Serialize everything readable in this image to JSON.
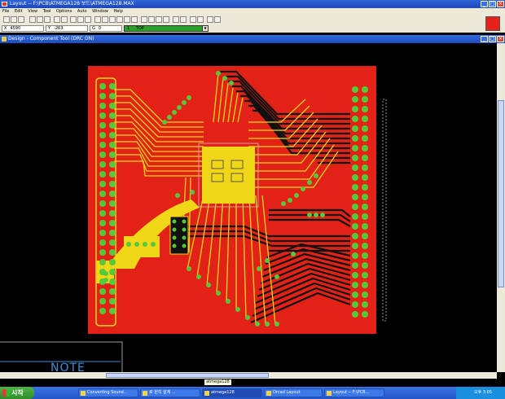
{
  "window": {
    "title": "Layout -- F:\\PCB\\ATMEGA128 보드\\ATMEGA128.MAX",
    "doc_title": "Design - Component Tool (DRC ON)"
  },
  "menu": [
    "File",
    "Edit",
    "View",
    "Tool",
    "Options",
    "Auto",
    "Window",
    "Help"
  ],
  "status": {
    "x_label": "X",
    "x_value": "4590",
    "y_label": "Y",
    "y_value": "-263",
    "g_label": "G",
    "g_value": "0",
    "layer_num": "1",
    "layer_name": "TOP"
  },
  "workspace": {
    "note_text": "NOTE",
    "tooltip": "atmega128"
  },
  "taskbar": {
    "start_label": "시작",
    "tasks": [
      "Converting Sound...",
      "로 원칙 설계 ...",
      "atmega128",
      "Orcad Layout",
      "Layout -- F:\\PCB..."
    ],
    "clock": "오후 3:05"
  },
  "colors": {
    "board": "#e32217",
    "trace": "#f0d818",
    "pad": "#56c83c",
    "background": "#000000",
    "bottom_trace": "#000000"
  }
}
